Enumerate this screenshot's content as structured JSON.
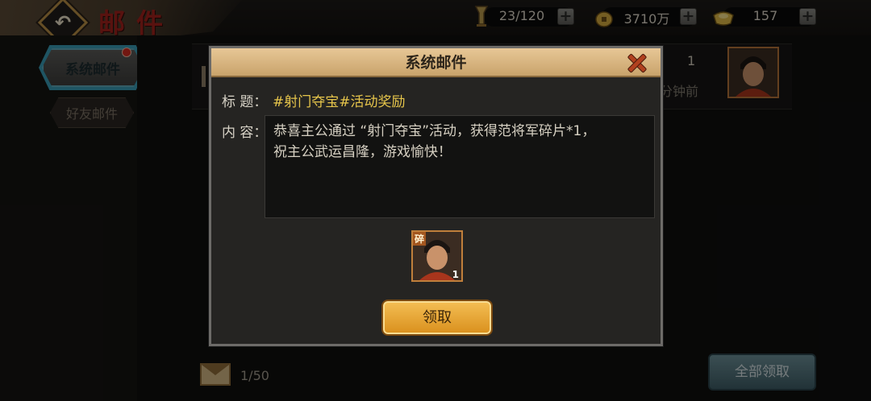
{
  "header": {
    "title": "邮件",
    "resources": [
      {
        "icon": "stamina-icon",
        "value": "23/120"
      },
      {
        "icon": "copper-coin-icon",
        "value": "3710万"
      },
      {
        "icon": "gold-ingot-icon",
        "value": "157"
      }
    ]
  },
  "tabs": [
    {
      "label": "系统邮件",
      "active": true,
      "badge": true
    },
    {
      "label": "好友邮件",
      "active": false
    }
  ],
  "background_list": {
    "count": "1",
    "time": "分钟前",
    "page_count": "1/50",
    "claim_all_label": "全部领取"
  },
  "dialog": {
    "title": "系统邮件",
    "subject_label": "标 题：",
    "subject": "#射门夺宝#活动奖励",
    "content_label": "内 容：",
    "content": "恭喜主公通过 “射门夺宝”活动，获得范将军碎片*1，\n祝主公武运昌隆，游戏愉快！",
    "reward": {
      "tag": "碎",
      "quantity": "1"
    },
    "claim_label": "领取"
  },
  "colors": {
    "title_red": "#a0221c",
    "subject_gold": "#e6c54b",
    "button_orange": "#e9a534",
    "tab_glow": "#47a8c0"
  }
}
